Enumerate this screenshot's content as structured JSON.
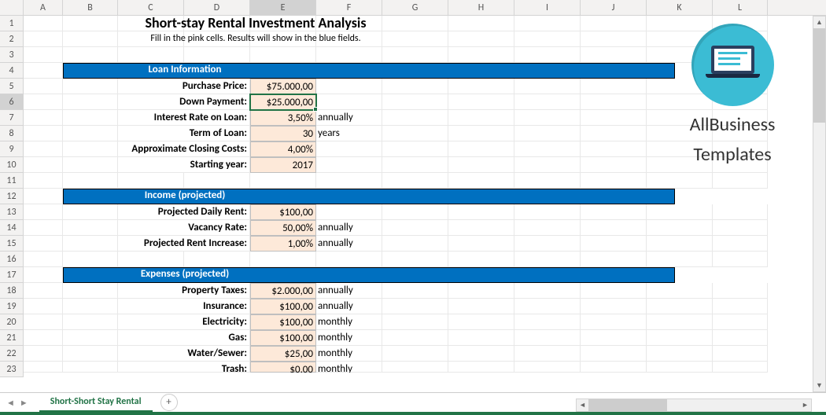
{
  "columns": [
    "A",
    "B",
    "C",
    "D",
    "E",
    "F",
    "G",
    "H",
    "I",
    "J",
    "K",
    "L"
  ],
  "active_col": "E",
  "active_row": 6,
  "title": "Short-stay Rental Investment Analysis",
  "subtitle": "Fill in the  pink cells. Results will show in the blue fields.",
  "sections": {
    "loan": {
      "header": "Loan Information",
      "rows": [
        {
          "label": "Purchase Price:",
          "value": "$75.000,00",
          "unit": ""
        },
        {
          "label": "Down Payment:",
          "value": "$25.000,00",
          "unit": ""
        },
        {
          "label": "Interest Rate on Loan:",
          "value": "3,50%",
          "unit": "annually"
        },
        {
          "label": "Term of Loan:",
          "value": "30",
          "unit": "years"
        },
        {
          "label": "Approximate Closing Costs:",
          "value": "4,00%",
          "unit": ""
        },
        {
          "label": "Starting year:",
          "value": "2017",
          "unit": ""
        }
      ]
    },
    "income": {
      "header": "Income (projected)",
      "rows": [
        {
          "label": "Projected Daily Rent:",
          "value": "$100,00",
          "unit": ""
        },
        {
          "label": "Vacancy Rate:",
          "value": "50,00%",
          "unit": "annually"
        },
        {
          "label": "Projected Rent Increase:",
          "value": "1,00%",
          "unit": "annually"
        }
      ]
    },
    "expenses": {
      "header": "Expenses (projected)",
      "rows": [
        {
          "label": "Property Taxes:",
          "value": "$2.000,00",
          "unit": "annually"
        },
        {
          "label": "Insurance:",
          "value": "$100,00",
          "unit": "annually"
        },
        {
          "label": "Electricity:",
          "value": "$100,00",
          "unit": "monthly"
        },
        {
          "label": "Gas:",
          "value": "$100,00",
          "unit": "monthly"
        },
        {
          "label": "Water/Sewer:",
          "value": "$25,00",
          "unit": "monthly"
        },
        {
          "label": "Trash:",
          "value": "$0,00",
          "unit": "monthly"
        }
      ]
    }
  },
  "sheet_tab": "Short-Short Stay Rental",
  "logo": {
    "line1": "AllBusiness",
    "line2": "Templates"
  }
}
